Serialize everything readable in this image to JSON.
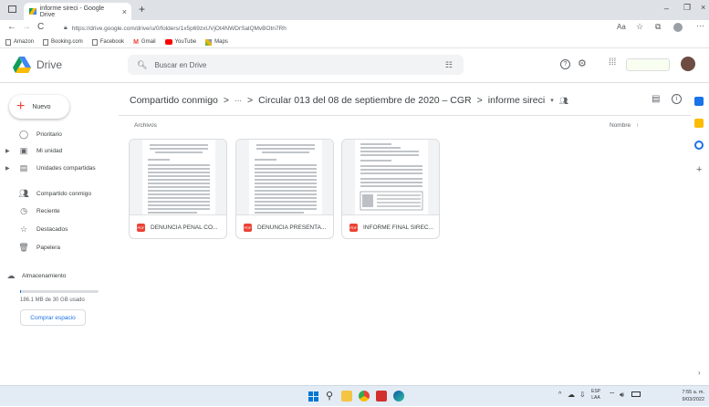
{
  "browser": {
    "tab_title": "informe sireci - Google Drive",
    "new_tab": "+",
    "url": "https://drive.google.com/drive/u/0/folders/1x5p69zxUVjOt4NWDrSalQMvBOtn7Rh",
    "bookmarks": [
      "Amazon",
      "Booking.com",
      "Facebook",
      "Gmail",
      "YouTube",
      "Maps"
    ]
  },
  "drive": {
    "app_name": "Drive",
    "search_placeholder": "Buscar en Drive",
    "new_button": "Nuevo",
    "nav": {
      "priority": "Prioritario",
      "my_drive": "Mi unidad",
      "shared_drives": "Unidades compartidas",
      "shared_with_me": "Compartido conmigo",
      "recent": "Reciente",
      "starred": "Destacados",
      "trash": "Papelera",
      "storage": "Almacenamiento"
    },
    "storage_used": "186.1 MB de 30 GB usado",
    "storage_fraction": 0.006,
    "buy_storage": "Comprar espacio",
    "breadcrumb": {
      "root": "Compartido conmigo",
      "ellipsis": "···",
      "sep": ">",
      "folder": "Circular 013 del 08 de septiembre de 2020 – CGR",
      "current": "informe sireci"
    },
    "files_label": "Archivos",
    "sort_label": "Nombre",
    "files": [
      {
        "name": "DENUNCIA PENAL CO...",
        "type": "PDF"
      },
      {
        "name": "DENUNCIA PRESENTA...",
        "type": "PDF"
      },
      {
        "name": "INFORME FINAL SIREC...",
        "type": "PDF"
      }
    ]
  },
  "taskbar": {
    "lang": "ESP",
    "lang_sub": "LAA",
    "time": "7:55 a. m.",
    "date": "9/03/2022"
  },
  "colors": {
    "accent_blue": "#1a73e8",
    "pdf_red": "#ea4335",
    "tab_strip": "#dee1e6"
  }
}
